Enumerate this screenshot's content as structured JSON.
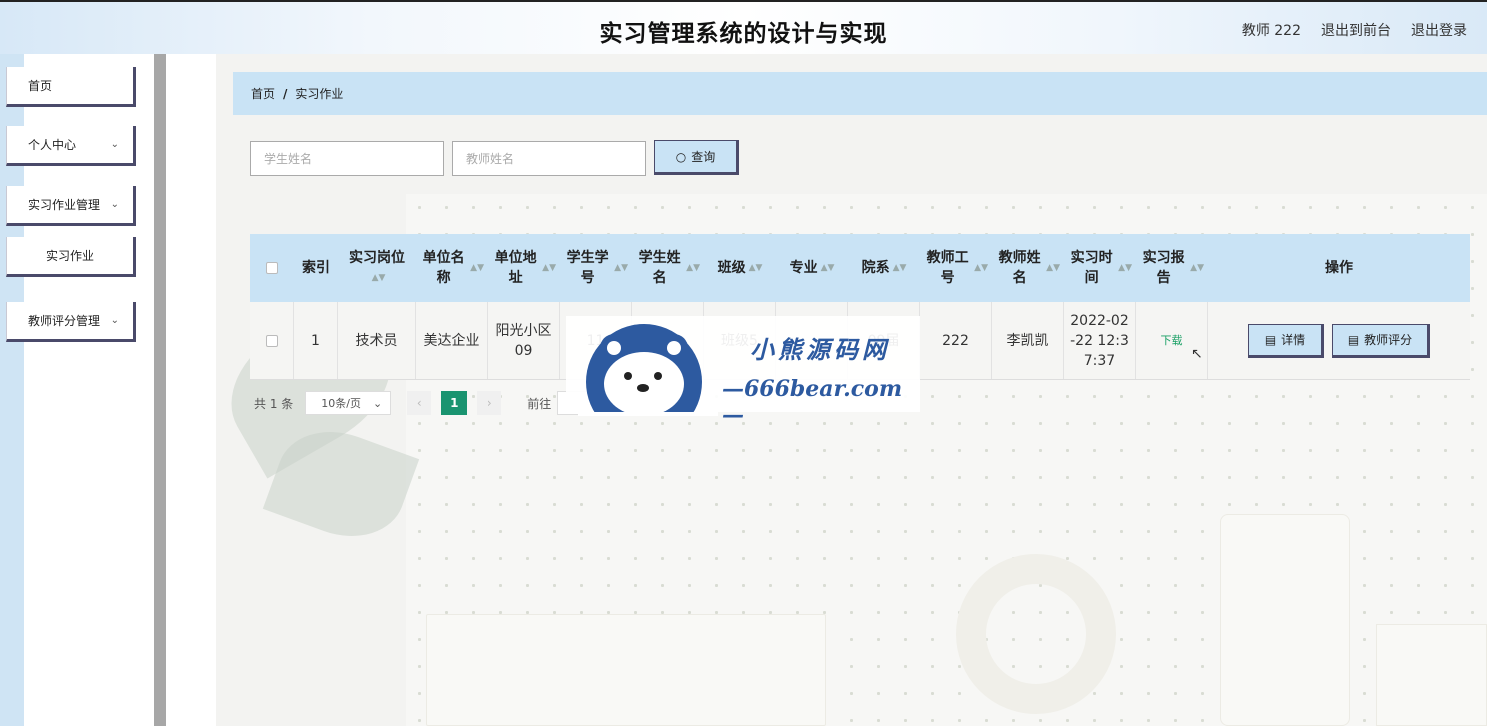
{
  "header": {
    "title": "实习管理系统的设计与实现",
    "user": "教师 222",
    "back_front": "退出到前台",
    "logout": "退出登录"
  },
  "sidebar": {
    "items": [
      {
        "label": "首页"
      },
      {
        "label": "个人中心"
      },
      {
        "label": "实习作业管理"
      },
      {
        "label": "实习作业"
      },
      {
        "label": "教师评分管理"
      }
    ]
  },
  "breadcrumb": {
    "home": "首页",
    "sep": "/",
    "current": "实习作业"
  },
  "search": {
    "student_placeholder": "学生姓名",
    "teacher_placeholder": "教师姓名",
    "button": "查询"
  },
  "table": {
    "headers": [
      "索引",
      "实习岗位",
      "单位名称",
      "单位地址",
      "学生学号",
      "学生姓名",
      "班级",
      "专业",
      "院系",
      "教师工号",
      "教师姓名",
      "实习时间",
      "实习报告",
      "操作"
    ],
    "rows": [
      {
        "index": "1",
        "position": "技术员",
        "company": "美达企业",
        "address": "阳光小区09",
        "student_no": "11",
        "student_name": "",
        "class": "班级5",
        "major": "",
        "dept": "09届",
        "teacher_no": "222",
        "teacher_name": "李凯凯",
        "time": "2022-02-22 12:37:37",
        "report": "下载",
        "detail_btn": "详情",
        "score_btn": "教师评分"
      }
    ]
  },
  "pagination": {
    "total": "共 1 条",
    "page_size": "10条/页",
    "current_page": "1",
    "goto": "前往"
  },
  "watermark": {
    "cn": "小熊源码网",
    "en": "—666bear.com—"
  }
}
